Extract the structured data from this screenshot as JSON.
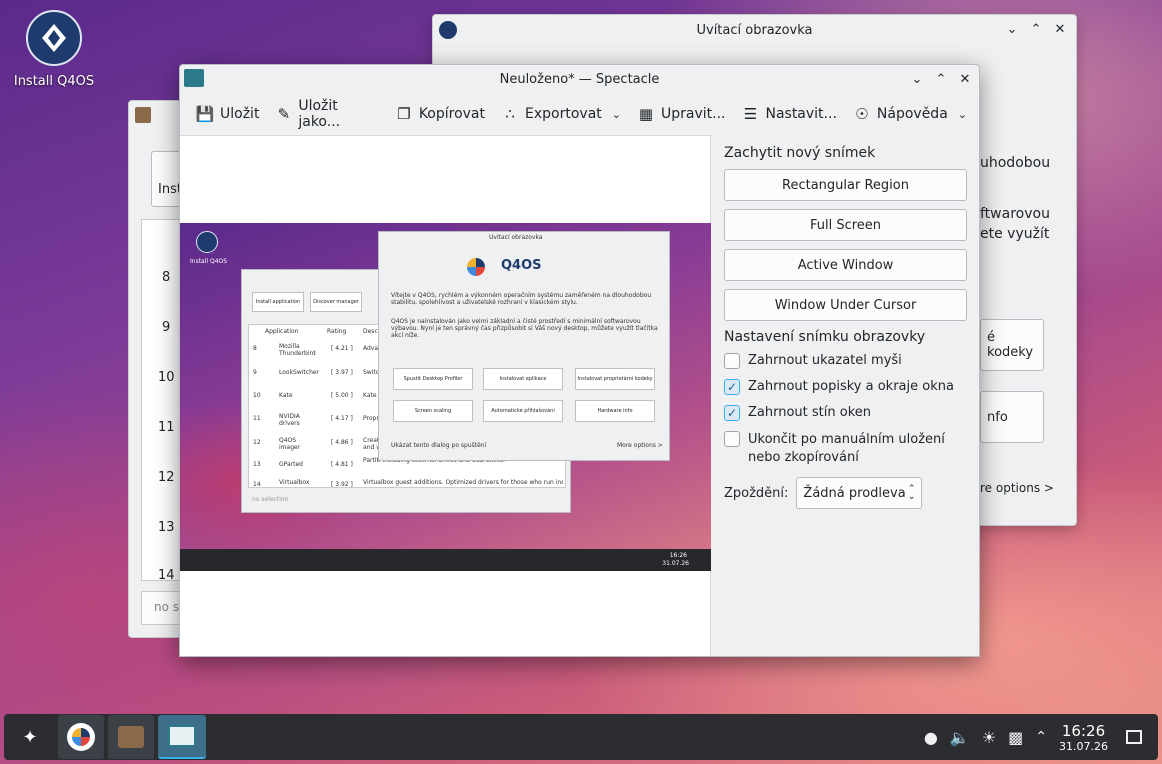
{
  "desktop": {
    "icon_label": "Install Q4OS"
  },
  "welcome": {
    "title": "Uvítací obrazovka",
    "frag1": "uhodobou",
    "frag2": "ftwarovou",
    "frag3": "ete využít",
    "btn1": "é kodeky",
    "btn2": "nfo",
    "more": "re options >"
  },
  "installer": {
    "frag": "Inst",
    "rows": [
      "8",
      "9",
      "10",
      "11",
      "12",
      "13",
      "14"
    ],
    "bottom": "no se"
  },
  "spectacle": {
    "title": "Neuloženo* — Spectacle",
    "toolbar": {
      "save": "Uložit",
      "save_as": "Uložit jako...",
      "copy": "Kopírovat",
      "export": "Exportovat",
      "edit": "Upravit...",
      "settings": "Nastavit...",
      "help": "Nápověda"
    },
    "capture": {
      "heading": "Zachytit nový snímek",
      "region": "Rectangular Region",
      "full": "Full Screen",
      "active": "Active Window",
      "under_cursor": "Window Under Cursor"
    },
    "options": {
      "heading": "Nastavení snímku obrazovky",
      "pointer": "Zahrnout ukazatel myši",
      "decorations": "Zahrnout popisky a okraje okna",
      "shadow": "Zahrnout stín oken",
      "quit": "Ukončit po manuálním uložení nebo zkopírování",
      "delay_label": "Zpoždění:",
      "delay_value": "Žádná prodleva"
    },
    "checks": {
      "pointer": false,
      "decorations": true,
      "shadow": true,
      "quit": false
    }
  },
  "preview": {
    "icon_label": "Install Q4OS",
    "welcome_title": "Uvítací obrazovka",
    "brand": "Q4OS",
    "intro1": "Vítejte v Q4OS, rychlém a výkonném operačním systému zaměřeném na dlouhodobou stabilitu, spolehlivost a uživatelské rozhraní v klasickém stylu.",
    "intro2": "Q4OS je nainstalován jako velmi základní a čisté prostředí s minimální softwarovou výbavou. Nyní je ten správný čas přizpůsobit si Váš nový desktop, můžete využít tlačítka akcí níže.",
    "buttons": [
      "Spustit Desktop Profiler",
      "Instalovat aplikace",
      "Instalovat proprietární kodeky",
      "Screen scaling",
      "Automatické přihlašování",
      "Hardware info"
    ],
    "show_label": "Ukázat tento dialog po spuštění",
    "more_options": "More options >",
    "inst_btns": [
      "Install application",
      "Discover manager"
    ],
    "cols": [
      "Application",
      "Rating",
      "Descr"
    ],
    "apps": [
      {
        "n": "8",
        "name": "Mozilla Thunderbird",
        "rating": "[ 4.21 ]",
        "desc": "Advan"
      },
      {
        "n": "9",
        "name": "LookSwitcher",
        "rating": "[ 3.97 ]",
        "desc": "Switch"
      },
      {
        "n": "10",
        "name": "Kate",
        "rating": "[ 5.00 ]",
        "desc": "Kate - p"
      },
      {
        "n": "11",
        "name": "NVIDIA drivers",
        "rating": "[ 4.17 ]",
        "desc": "Propri"
      },
      {
        "n": "12",
        "name": "Q4OS imager",
        "rating": "[ 4.86 ]",
        "desc": "Create and wr"
      },
      {
        "n": "13",
        "name": "GParted",
        "rating": "[ 4.81 ]",
        "desc": "Partiti including external drives and USB sticks."
      },
      {
        "n": "14",
        "name": "Virtualbox",
        "rating": "[ 3.92 ]",
        "desc": "Virtualbox guest additions. Optimized drivers for those who run inside"
      }
    ],
    "no_selection": "no selection",
    "clock_time": "16:26",
    "clock_date": "31.07.26"
  },
  "panel": {
    "time": "16:26",
    "date": "31.07.26"
  }
}
